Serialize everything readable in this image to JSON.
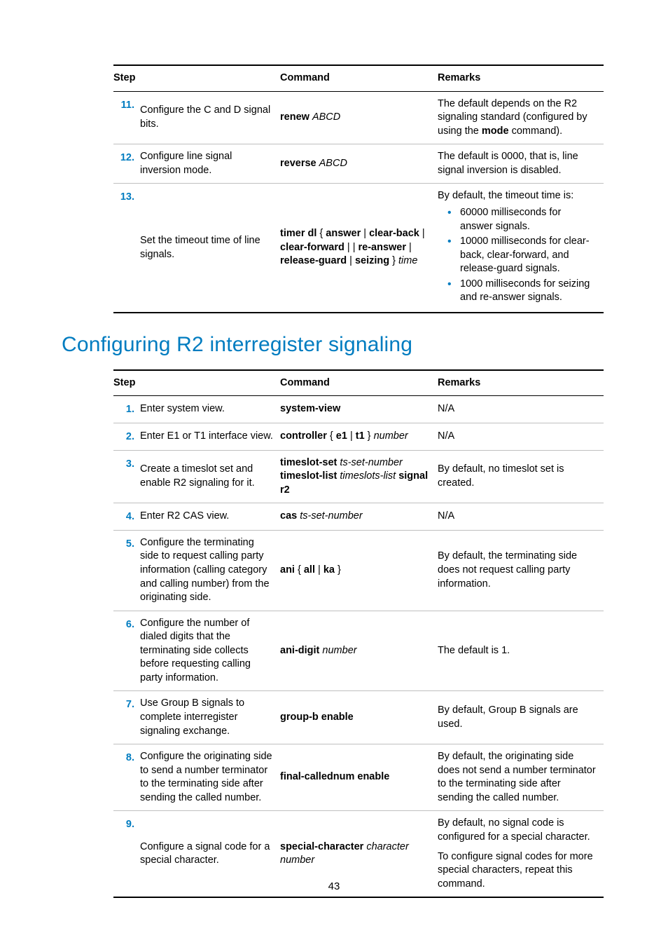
{
  "page_number": "43",
  "table1": {
    "headers": {
      "step": "Step",
      "command": "Command",
      "remarks": "Remarks"
    },
    "rows": [
      {
        "num": "11.",
        "step": "Configure the C and D signal bits.",
        "cmd_parts": [
          {
            "t": "renew ",
            "b": true
          },
          {
            "t": "ABCD",
            "i": true
          }
        ],
        "remarks_pre": "The default depends on the R2 signaling standard (configured by using the ",
        "remarks_bold": "mode",
        "remarks_post": " command)."
      },
      {
        "num": "12.",
        "step": "Configure line signal inversion mode.",
        "cmd_parts": [
          {
            "t": "reverse ",
            "b": true
          },
          {
            "t": "ABCD",
            "i": true
          }
        ],
        "remarks_plain": "The default is 0000, that is, line signal inversion is disabled."
      },
      {
        "num": "13.",
        "step": "Set the timeout time of line signals.",
        "cmd_parts": [
          {
            "t": "timer dl",
            "b": true
          },
          {
            "t": " { "
          },
          {
            "t": "answer",
            "b": true
          },
          {
            "t": " | "
          },
          {
            "t": "clear-back",
            "b": true
          },
          {
            "t": " | "
          },
          {
            "t": "clear-forward",
            "b": true
          },
          {
            "t": " |  | "
          },
          {
            "t": "re-answer",
            "b": true
          },
          {
            "t": " | "
          },
          {
            "t": "release-guard",
            "b": true
          },
          {
            "t": " | "
          },
          {
            "t": "seizing",
            "b": true
          },
          {
            "t": " } "
          },
          {
            "t": "time",
            "i": true
          }
        ],
        "remarks_lead": "By default, the timeout time is:",
        "remarks_list": [
          "60000 milliseconds for answer signals.",
          "10000 milliseconds for clear-back, clear-forward, and release-guard signals.",
          "1000 milliseconds for seizing and re-answer signals."
        ]
      }
    ]
  },
  "section_title": "Configuring R2 interregister signaling",
  "table2": {
    "headers": {
      "step": "Step",
      "command": "Command",
      "remarks": "Remarks"
    },
    "rows": [
      {
        "num": "1.",
        "step": "Enter system view.",
        "cmd_parts": [
          {
            "t": "system-view",
            "b": true
          }
        ],
        "remarks_plain": "N/A"
      },
      {
        "num": "2.",
        "step": "Enter E1 or T1 interface view.",
        "cmd_parts": [
          {
            "t": "controller",
            "b": true
          },
          {
            "t": " { "
          },
          {
            "t": "e1",
            "b": true
          },
          {
            "t": " | "
          },
          {
            "t": "t1",
            "b": true
          },
          {
            "t": " } "
          },
          {
            "t": "number",
            "i": true
          }
        ],
        "remarks_plain": "N/A"
      },
      {
        "num": "3.",
        "step": "Create a timeslot set and enable R2 signaling for it.",
        "cmd_parts": [
          {
            "t": "timeslot-set ",
            "b": true
          },
          {
            "t": "ts-set-number",
            "i": true
          },
          {
            "t": " "
          },
          {
            "t": "timeslot-list ",
            "b": true
          },
          {
            "t": "timeslots-list",
            "i": true
          },
          {
            "t": " "
          },
          {
            "t": "signal r2",
            "b": true
          }
        ],
        "remarks_plain": "By default, no timeslot set is created."
      },
      {
        "num": "4.",
        "step": "Enter R2 CAS view.",
        "cmd_parts": [
          {
            "t": "cas ",
            "b": true
          },
          {
            "t": "ts-set-number",
            "i": true
          }
        ],
        "remarks_plain": "N/A"
      },
      {
        "num": "5.",
        "step": "Configure the terminating side to request calling party information (calling category and calling number) from the originating side.",
        "cmd_parts": [
          {
            "t": "ani",
            "b": true
          },
          {
            "t": " { "
          },
          {
            "t": "all",
            "b": true
          },
          {
            "t": " | "
          },
          {
            "t": "ka",
            "b": true
          },
          {
            "t": " }"
          }
        ],
        "remarks_plain": "By default, the terminating side does not request calling party information."
      },
      {
        "num": "6.",
        "step": "Configure the number of dialed digits that the terminating side collects before requesting calling party information.",
        "cmd_parts": [
          {
            "t": "ani-digit ",
            "b": true
          },
          {
            "t": "number",
            "i": true
          }
        ],
        "remarks_plain": "The default is 1."
      },
      {
        "num": "7.",
        "step": "Use Group B signals to complete interregister signaling exchange.",
        "cmd_parts": [
          {
            "t": "group-b enable",
            "b": true
          }
        ],
        "remarks_plain": "By default, Group B signals are used."
      },
      {
        "num": "8.",
        "step": "Configure the originating side to send a number terminator to the terminating side after sending the called number.",
        "cmd_parts": [
          {
            "t": "final-callednum enable",
            "b": true
          }
        ],
        "remarks_plain": "By default, the originating side does not send a number terminator to the terminating side after sending the called number."
      },
      {
        "num": "9.",
        "step": "Configure a signal code for a special character.",
        "cmd_parts": [
          {
            "t": "special-character ",
            "b": true
          },
          {
            "t": "character",
            "i": true
          },
          {
            "t": " "
          },
          {
            "t": "number",
            "i": true
          }
        ],
        "remarks_para1": "By default, no signal code is configured for a special character.",
        "remarks_para2": "To configure signal codes for more special characters, repeat this command."
      }
    ]
  }
}
